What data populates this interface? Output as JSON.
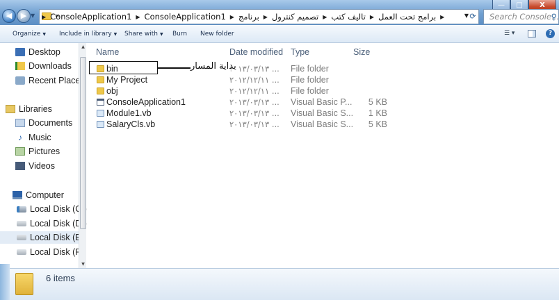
{
  "window": {
    "minimize_label": "—",
    "maximize_label": "□",
    "close_label": "X"
  },
  "address": {
    "overflow": "«",
    "crumbs": [
      "برامج تحت العمل",
      "تاليف كتب",
      "تصميم كنترول",
      "برنامج",
      "ConsoleApplication1",
      "ConsoleApplication1"
    ],
    "search_placeholder": "Search Console..."
  },
  "toolbar": {
    "organize": "Organize",
    "include": "Include in library",
    "share": "Share with",
    "burn": "Burn",
    "new_folder": "New folder"
  },
  "navigation": {
    "favorites": [
      "Desktop",
      "Downloads",
      "Recent Places"
    ],
    "libraries": "Libraries",
    "library_items": [
      "Documents",
      "Music",
      "Pictures",
      "Videos"
    ],
    "computer": "Computer",
    "disks": [
      "Local Disk (C:)",
      "Local Disk (D:)",
      "Local Disk (E:)",
      "Local Disk (F:)"
    ],
    "selected": "Local Disk (E:)"
  },
  "columns": {
    "name": "Name",
    "date": "Date modified",
    "type": "Type",
    "size": "Size"
  },
  "files": [
    {
      "name": "bin",
      "date": "٢٠١٣/٠٣/١٣ ...",
      "type": "File folder",
      "size": "",
      "icon": "folder-icon"
    },
    {
      "name": "My Project",
      "date": "٢٠١٢/١٢/١١ ...",
      "type": "File folder",
      "size": "",
      "icon": "folder-icon"
    },
    {
      "name": "obj",
      "date": "٢٠١٢/١٢/١١ ...",
      "type": "File folder",
      "size": "",
      "icon": "folder-icon"
    },
    {
      "name": "ConsoleApplication1",
      "date": "٢٠١٣/٠٣/١٣ ...",
      "type": "Visual Basic P...",
      "size": "5 KB",
      "icon": "vb-project-icon"
    },
    {
      "name": "Module1.vb",
      "date": "٢٠١٣/٠٣/١٣ ...",
      "type": "Visual Basic S...",
      "size": "1 KB",
      "icon": "vb-file-icon"
    },
    {
      "name": "SalaryCls.vb",
      "date": "٢٠١٣/٠٣/١٣ ...",
      "type": "Visual Basic S...",
      "size": "5 KB",
      "icon": "vb-file-icon"
    }
  ],
  "annotation": {
    "label": "بداية المسار"
  },
  "details": {
    "item_count": "6 items"
  }
}
